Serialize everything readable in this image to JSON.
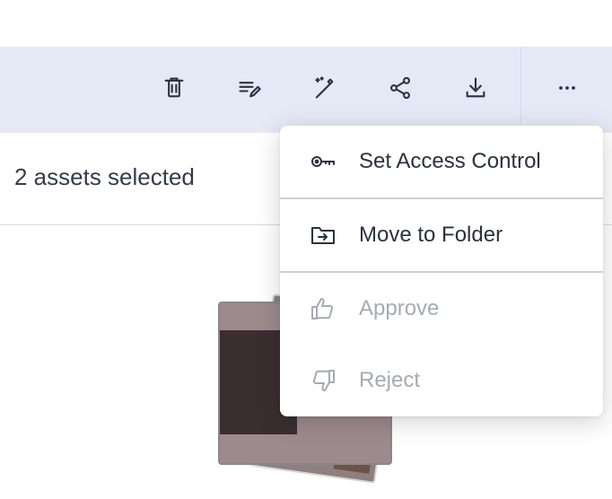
{
  "toolbar": {
    "actions": [
      {
        "name": "delete",
        "icon": "trash-icon"
      },
      {
        "name": "edit-metadata",
        "icon": "list-edit-icon"
      },
      {
        "name": "magic",
        "icon": "magic-wand-icon"
      },
      {
        "name": "share",
        "icon": "share-icon"
      },
      {
        "name": "download",
        "icon": "download-icon"
      },
      {
        "name": "more",
        "icon": "more-horizontal-icon"
      }
    ]
  },
  "selection": {
    "label": "2 assets selected"
  },
  "context_menu": {
    "items": [
      {
        "label": "Set Access Control",
        "icon": "key-icon",
        "enabled": true
      },
      {
        "label": "Move to Folder",
        "icon": "folder-move-icon",
        "enabled": true
      },
      {
        "label": "Approve",
        "icon": "thumbs-up-icon",
        "enabled": false
      },
      {
        "label": "Reject",
        "icon": "thumbs-down-icon",
        "enabled": false
      }
    ]
  },
  "colors": {
    "toolbar_bg": "#e5e9f6",
    "text_primary": "#2b3140",
    "text_disabled": "#a7aab2"
  }
}
